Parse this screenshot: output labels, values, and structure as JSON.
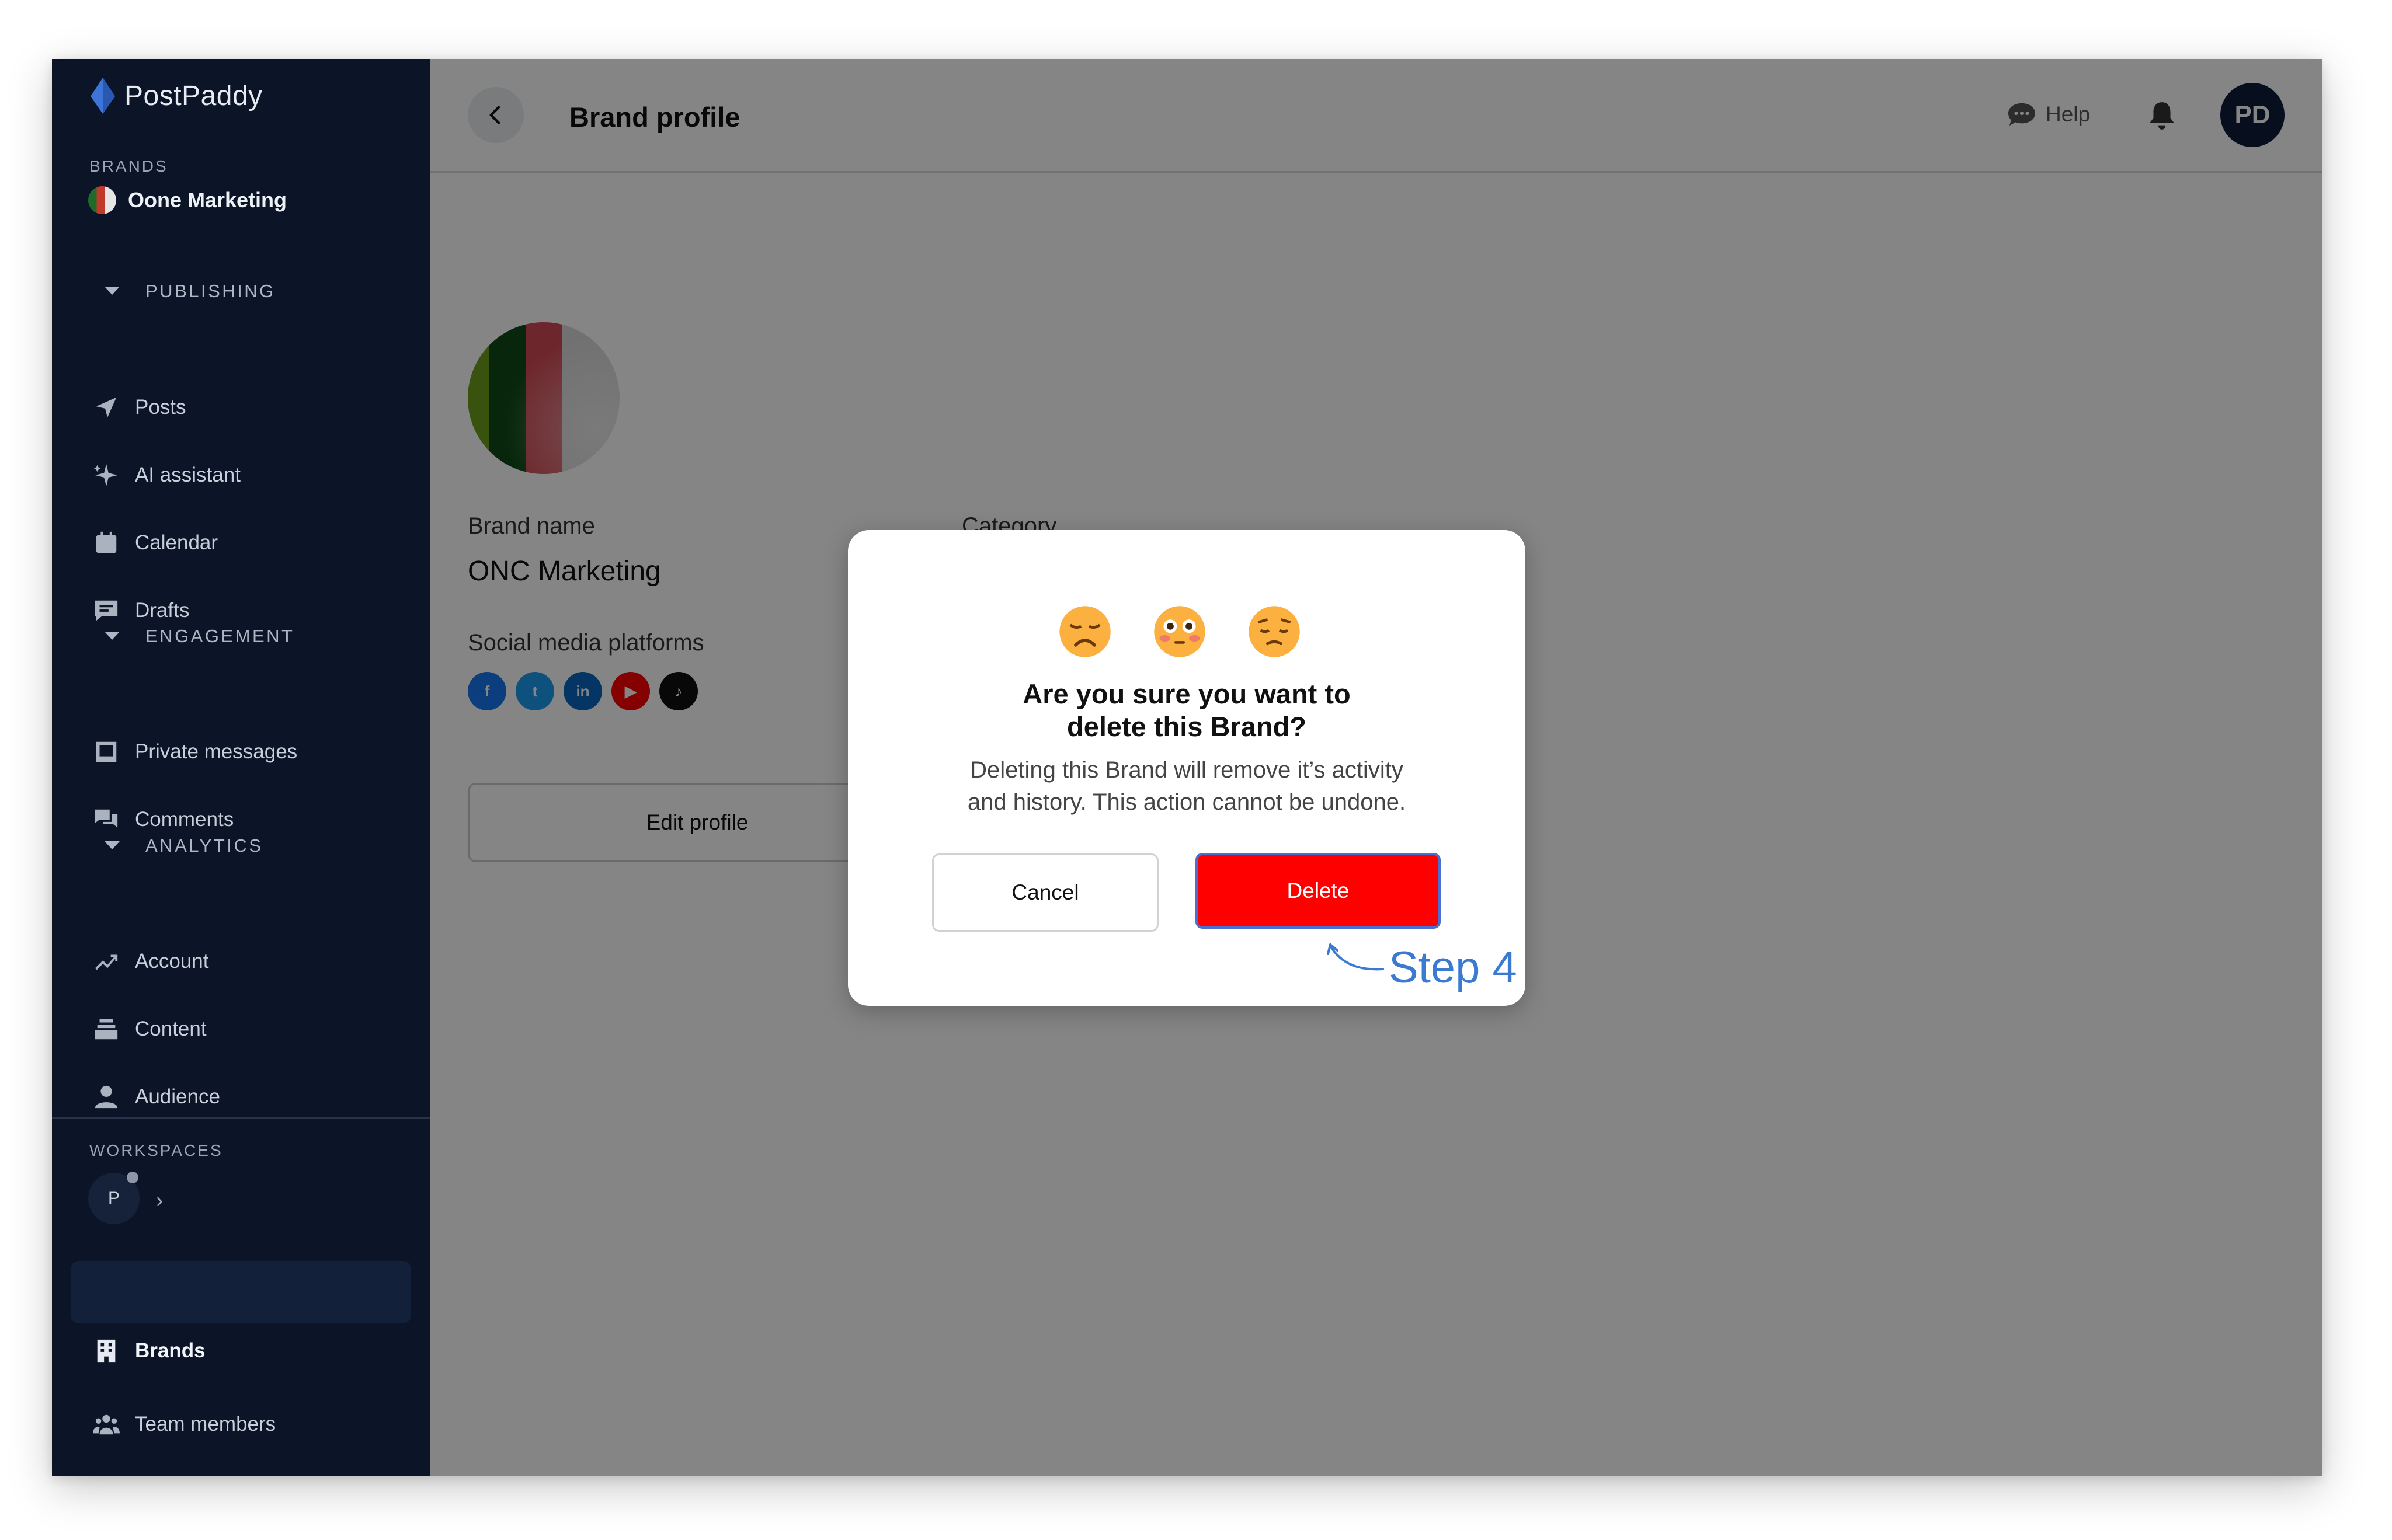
{
  "app": {
    "name": "PostPaddy"
  },
  "sidebar": {
    "brands_label": "BRANDS",
    "current_brand": "Oone Marketing",
    "groups": [
      {
        "label": "PUBLISHING",
        "items": [
          {
            "label": "Posts",
            "icon": "send-icon"
          },
          {
            "label": "AI assistant",
            "icon": "sparkle-icon"
          },
          {
            "label": "Calendar",
            "icon": "calendar-icon"
          },
          {
            "label": "Drafts",
            "icon": "drafts-icon"
          }
        ]
      },
      {
        "label": "ENGAGEMENT",
        "items": [
          {
            "label": "Private messages",
            "icon": "inbox-icon"
          },
          {
            "label": "Comments",
            "icon": "comments-icon"
          }
        ]
      },
      {
        "label": "ANALYTICS",
        "items": [
          {
            "label": "Account",
            "icon": "trend-icon"
          },
          {
            "label": "Content",
            "icon": "stack-icon"
          },
          {
            "label": "Audience",
            "icon": "user-icon"
          }
        ]
      }
    ],
    "workspaces_label": "WORKSPACES",
    "workspace_initial": "P",
    "bottom_items": [
      {
        "label": "Brands",
        "icon": "building-icon",
        "active": true
      },
      {
        "label": "Team members",
        "icon": "team-icon",
        "active": false
      }
    ]
  },
  "header": {
    "title": "Brand profile",
    "help_label": "Help",
    "avatar_initials": "PD"
  },
  "profile": {
    "brand_name_label": "Brand name",
    "brand_name": "ONC Marketing",
    "category_label": "Category",
    "social_label": "Social media platforms",
    "socials": [
      {
        "name": "facebook",
        "glyph": "f",
        "color": "#1877f2"
      },
      {
        "name": "twitter",
        "glyph": "t",
        "color": "#1d9bf0"
      },
      {
        "name": "linkedin",
        "glyph": "in",
        "color": "#0a66c2"
      },
      {
        "name": "youtube",
        "glyph": "▶",
        "color": "#ff0000"
      },
      {
        "name": "tiktok",
        "glyph": "♪",
        "color": "#111111"
      }
    ],
    "edit_button": "Edit profile"
  },
  "modal": {
    "title_line1": "Are you sure you want to",
    "title_line2": "delete this Brand?",
    "text_line1": "Deleting this Brand will remove it’s activity",
    "text_line2": "and history. This action cannot be undone.",
    "cancel_label": "Cancel",
    "delete_label": "Delete",
    "delete_color": "#ff0000"
  },
  "annotation": {
    "step_label": "Step 4",
    "color": "#3a7ad0"
  }
}
